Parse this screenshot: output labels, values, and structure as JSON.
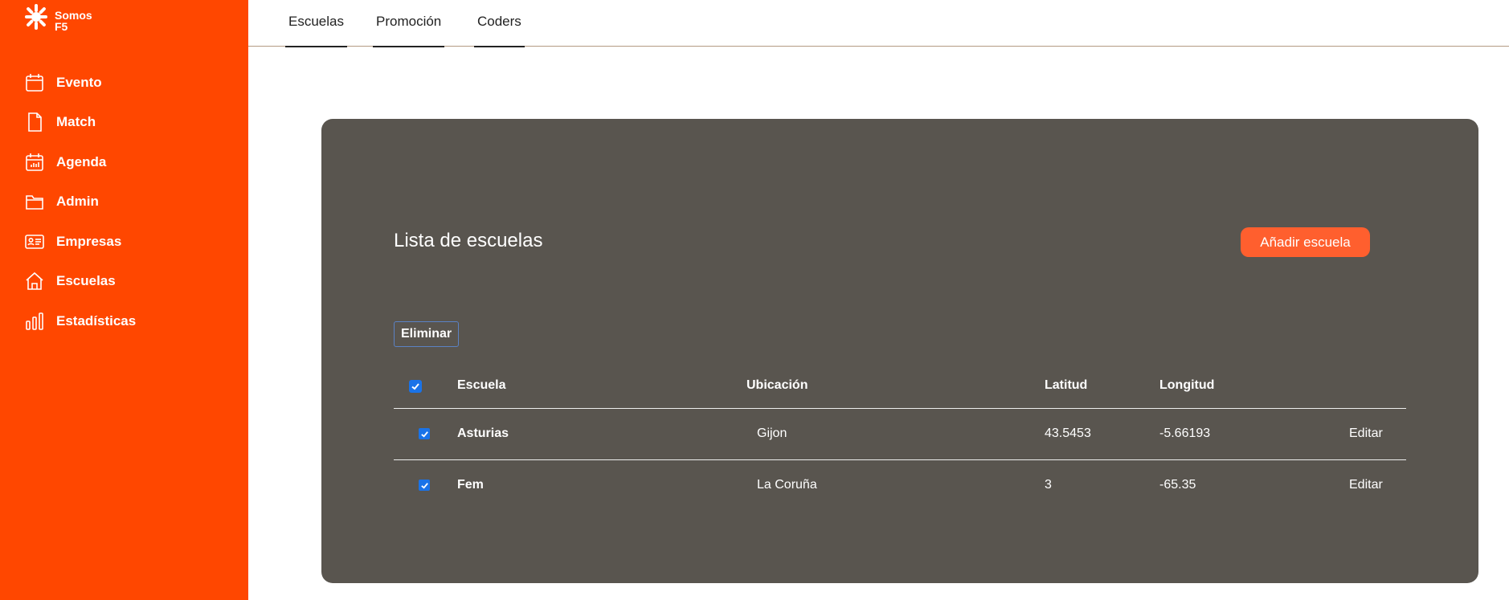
{
  "brand": {
    "name": "Somos\nF5"
  },
  "sidebar": {
    "items": [
      {
        "label": "Evento",
        "icon": "calendar-icon"
      },
      {
        "label": "Match",
        "icon": "document-icon"
      },
      {
        "label": "Agenda",
        "icon": "calendar-grid-icon"
      },
      {
        "label": "Admin",
        "icon": "folder-icon"
      },
      {
        "label": "Empresas",
        "icon": "id-card-icon"
      },
      {
        "label": "Escuelas",
        "icon": "home-icon"
      },
      {
        "label": "Estadísticas",
        "icon": "bar-chart-icon"
      }
    ]
  },
  "topnav": {
    "tabs": [
      {
        "label": "Escuelas"
      },
      {
        "label": "Promoción"
      },
      {
        "label": "Coders"
      }
    ]
  },
  "main": {
    "title": "Lista de escuelas",
    "add_button": "Añadir escuela",
    "delete_button": "Eliminar",
    "table": {
      "headers": {
        "school": "Escuela",
        "location": "Ubicación",
        "lat": "Latitud",
        "lon": "Longitud"
      },
      "rows": [
        {
          "school": "Asturias",
          "location": "Gijon",
          "lat": "43.5453",
          "lon": "-5.66193",
          "action": "Editar",
          "checked": true
        },
        {
          "school": "Fem",
          "location": "La Coruña",
          "lat": "3",
          "lon": "-65.35",
          "action": "Editar",
          "checked": true
        }
      ]
    }
  },
  "colors": {
    "sidebar": "#ff4700",
    "panel": "#59554f",
    "accent_button": "#ff5f2e",
    "checkbox": "#1a73e8"
  }
}
